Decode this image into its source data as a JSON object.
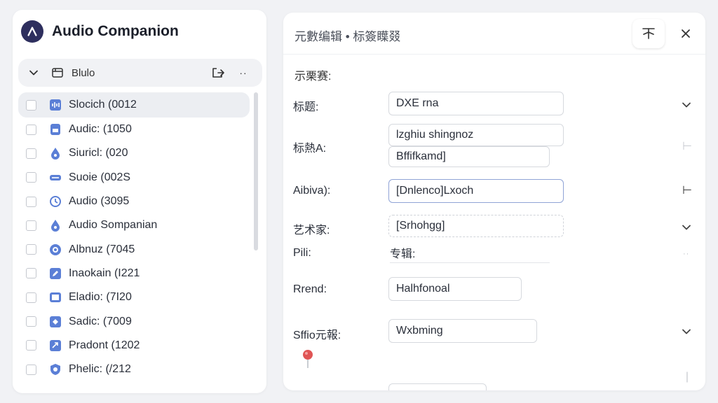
{
  "app": {
    "title": "Audio Companion"
  },
  "colors": {
    "accent": "#2e2f5e",
    "selection": "#eceef2",
    "focus_border": "#8fa3d6",
    "marker": "#e05555",
    "file_icon": "#5b7fd6"
  },
  "folder": {
    "name": "Blulo"
  },
  "files": [
    {
      "name": "Slocich (0012",
      "icon": "waveform-icon",
      "selected": true
    },
    {
      "name": "Audic: (1050",
      "icon": "audio-file-icon",
      "selected": false
    },
    {
      "name": "Siuricl: (020",
      "icon": "drop-icon",
      "selected": false
    },
    {
      "name": "Suoie (002S",
      "icon": "dash-icon",
      "selected": false
    },
    {
      "name": "Audio (3095",
      "icon": "refresh-icon",
      "selected": false
    },
    {
      "name": "Audio Sompanian",
      "icon": "drop-icon",
      "selected": false
    },
    {
      "name": "Albnuz (7045",
      "icon": "disc-icon",
      "selected": false
    },
    {
      "name": "Inaokain (I221",
      "icon": "edit-icon",
      "selected": false
    },
    {
      "name": "Eladio: (7I20",
      "icon": "square-icon",
      "selected": false
    },
    {
      "name": "Sadic: (7009",
      "icon": "tag-icon",
      "selected": false
    },
    {
      "name": "Pradont (1202",
      "icon": "share-icon",
      "selected": false
    },
    {
      "name": "Phelic: (/212",
      "icon": "shield-icon",
      "selected": false
    }
  ],
  "editor": {
    "title": "元數编辑 • 标簽瞸叕",
    "section_label": "示栗赛:",
    "fields": {
      "title": {
        "label": "标题:",
        "value": "DXE rna"
      },
      "tags": {
        "label": "标熱A:",
        "value1": "lzghiu shingnoz",
        "value2": "Bffifkamd]"
      },
      "album": {
        "label": "Aibiva):",
        "value": "[Dnlenco]Lxoch"
      },
      "artist": {
        "label": "艺术家:",
        "value": "[Srhohgg]"
      },
      "album2": {
        "label": "Pili:",
        "value": "专辑:"
      },
      "trend": {
        "label": "Rrend:",
        "value": "Halhfonoal"
      },
      "style": {
        "label": "Sffio元報:",
        "value": "Wxbming"
      }
    }
  }
}
